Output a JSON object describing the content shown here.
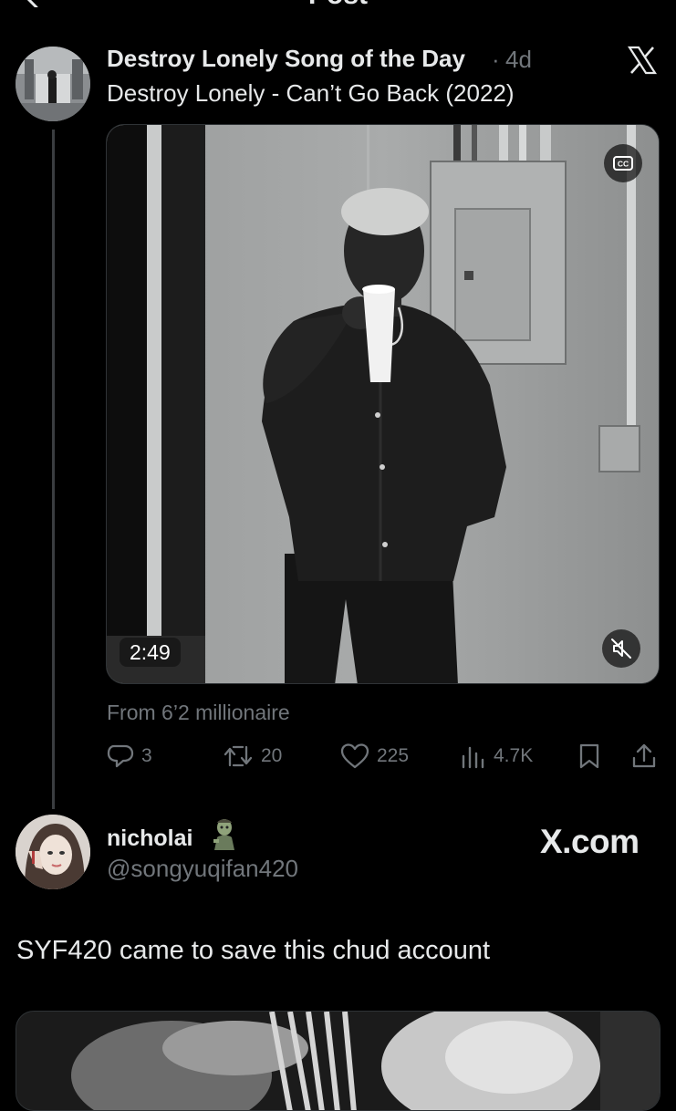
{
  "header": {
    "title": "Post"
  },
  "post": {
    "display_name": "Destroy Lonely Song of the Day",
    "separator": "·",
    "age": "4d",
    "text": "Destroy Lonely - Can’t Go Back (2022)",
    "video": {
      "duration": "2:49",
      "cc_icon": "closed-captions-icon",
      "mute_icon": "speaker-muted-icon"
    },
    "source": "From 6’2 millionaire",
    "stats": {
      "replies": "3",
      "reposts": "20",
      "likes": "225",
      "views": "4.7K"
    }
  },
  "quoted": {
    "display_name": "nicholai",
    "emoji": "zombie-emoji",
    "handle": "@songyuqifan420",
    "watermark": "X.com",
    "text": "SYF420 came to save this chud account"
  },
  "icons": {
    "back": "chevron-left-icon",
    "more": "more-horizontal-icon",
    "logo": "x-logo-icon",
    "reply": "reply-icon",
    "repost": "repost-icon",
    "like": "heart-icon",
    "views": "views-icon",
    "bookmark": "bookmark-icon",
    "share": "share-icon"
  }
}
